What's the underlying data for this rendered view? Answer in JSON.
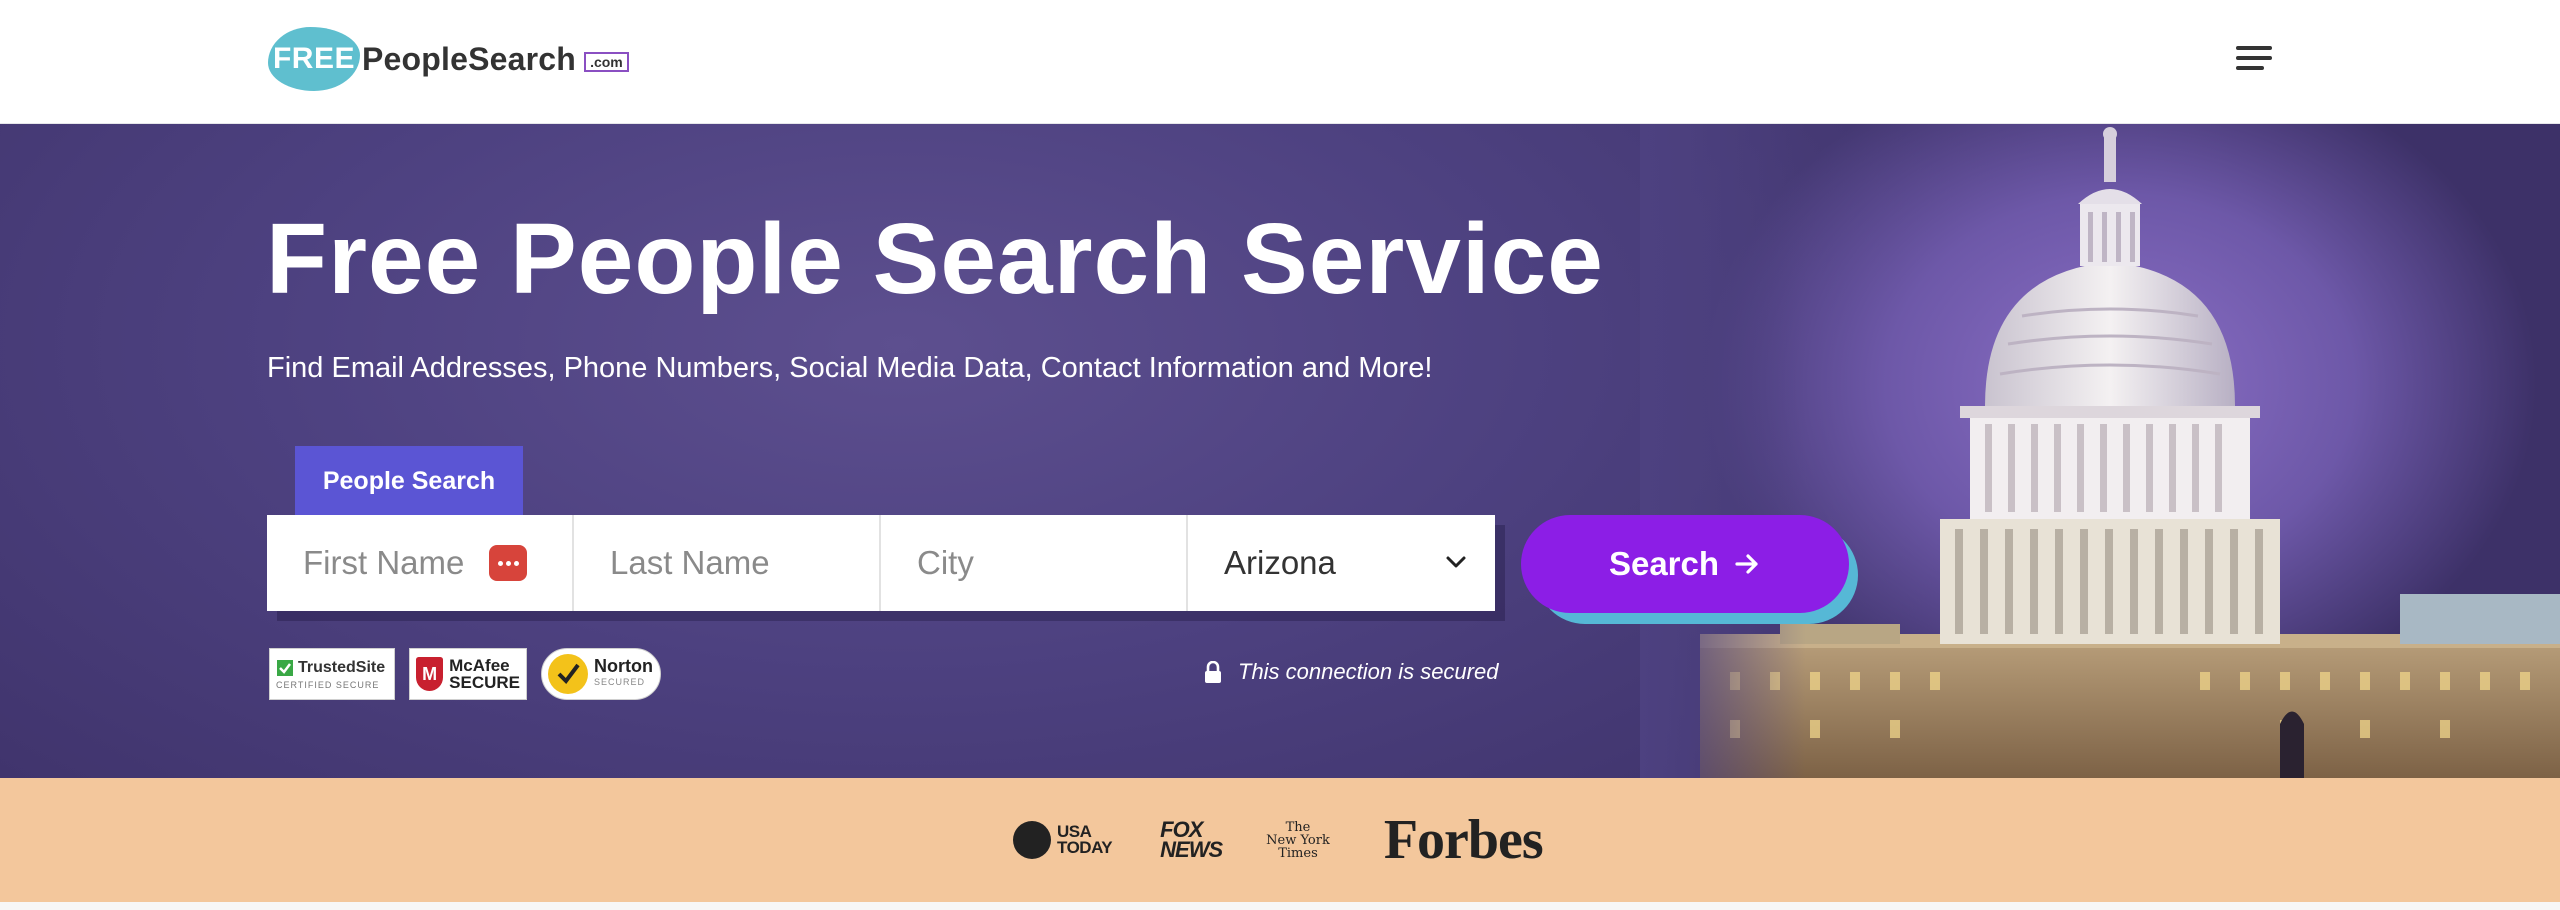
{
  "header": {
    "logo_free": "FREE",
    "logo_name": "PeopleSearch",
    "logo_com": ".com",
    "menu_icon": "hamburger-menu-icon"
  },
  "hero": {
    "title": "Free People Search Service",
    "subtitle": "Find Email Addresses, Phone Numbers, Social Media Data, Contact Information and More!",
    "tab_label": "People Search",
    "form": {
      "first_name_placeholder": "First Name",
      "last_name_placeholder": "Last Name",
      "city_placeholder": "City",
      "state_value": "Arizona"
    },
    "search_label": "Search",
    "secure_text": "This connection is secured",
    "badges": {
      "trusted_title": "TrustedSite",
      "trusted_sub": "CERTIFIED SECURE",
      "mcafee_line1": "McAfee",
      "mcafee_line2": "SECURE",
      "norton_title": "Norton",
      "norton_sub": "SECURED"
    },
    "background_image": "us-capitol-building"
  },
  "press": {
    "usa_today_line1": "USA",
    "usa_today_line2": "TODAY",
    "fox_line1": "FOX",
    "fox_line2": "NEWS",
    "nyt_line1": "The",
    "nyt_line2": "New York",
    "nyt_line3": "Times",
    "forbes": "Forbes"
  },
  "colors": {
    "hero_bg": "#4d4180",
    "tab": "#5b55d4",
    "search_button": "#8c1ee6",
    "search_shadow": "#56b8d6",
    "logo_blob": "#5fbfcf",
    "press_strip": "#f3c79c"
  }
}
